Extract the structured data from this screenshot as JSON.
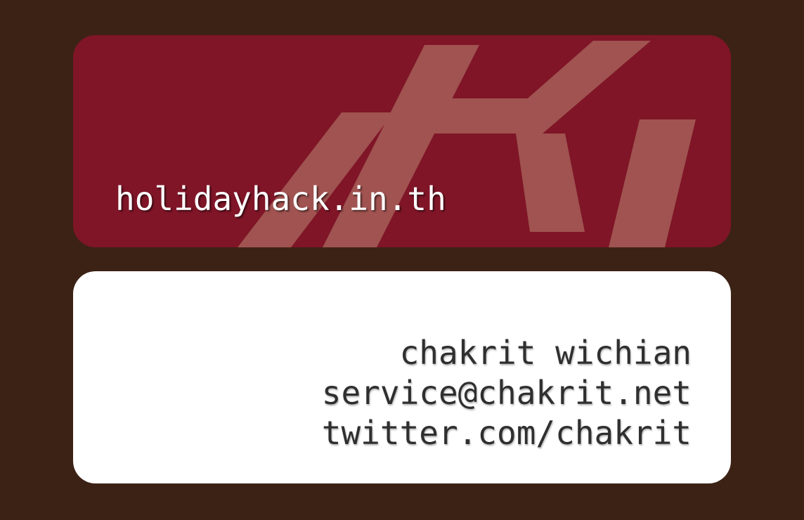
{
  "front": {
    "site": "holidayhack.in.th",
    "logo_icon": "hh-monogram-icon"
  },
  "back": {
    "name": "chakrit wichian",
    "email": "service@chakrit.net",
    "twitter": "twitter.com/chakrit"
  },
  "colors": {
    "background": "#3c2215",
    "front_card": "#7f1527",
    "logo_mark": "#a05350",
    "back_card": "#ffffff",
    "contact_text": "#2f2f2f"
  }
}
